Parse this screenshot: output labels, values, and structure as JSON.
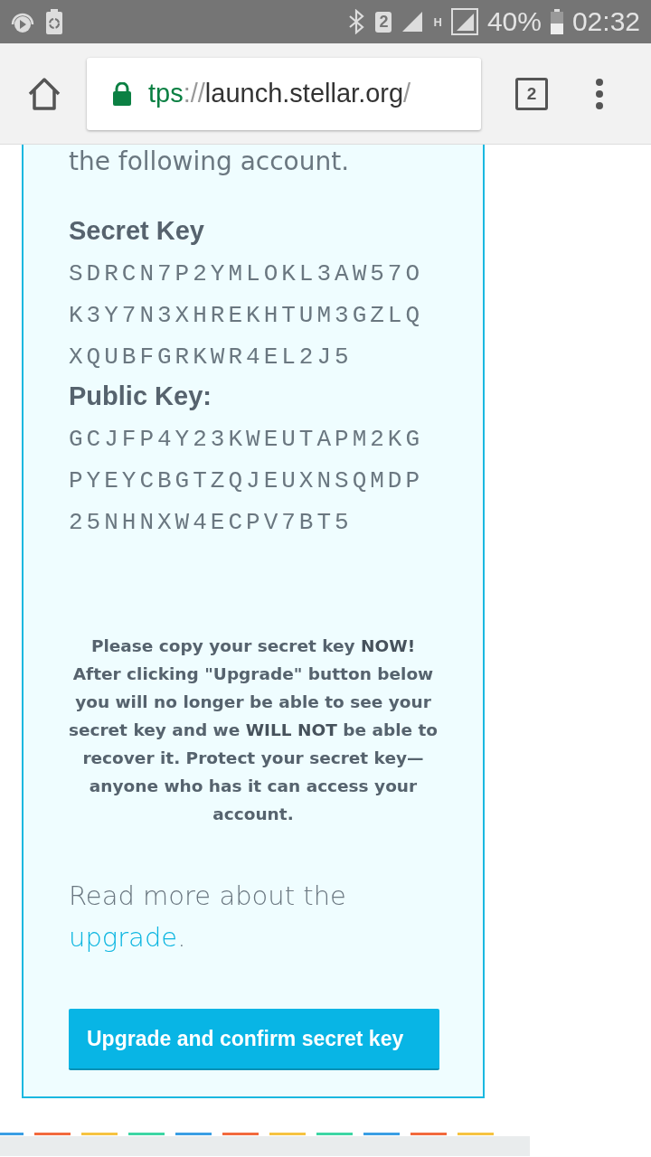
{
  "status_bar": {
    "sim_slot": "2",
    "network_type": "H",
    "battery_percent": "40%",
    "time": "02:32"
  },
  "browser_toolbar": {
    "url": {
      "scheme": "tps",
      "separator": "://",
      "host": "launch.stellar.org",
      "path": "/"
    },
    "tab_count": "2"
  },
  "card": {
    "intro_tail": "the following account.",
    "secret_key": {
      "label": "Secret Key",
      "value": "SDRCN7P2YMLOKL3AW57OK3Y7N3XHREKHTUM3GZLQXQUBFGRKWR4EL2J5"
    },
    "public_key": {
      "label": "Public Key:",
      "value": "GCJFP4Y23KWEUTAPM2KGPYEYCBGTZQJEUXNSQMDP25NHNXW4ECPV7BT5"
    },
    "warning": "Please copy your secret key **NOW!** After clicking \"Upgrade\" button below you will no longer be able to see your secret key and we **WILL NOT** be able to recover it. Protect your secret key—anyone who has it can access your account.",
    "read_more": {
      "text": "Read more about the ",
      "link": "upgrade",
      "tail": "."
    },
    "button": "Upgrade and confirm secret key"
  }
}
